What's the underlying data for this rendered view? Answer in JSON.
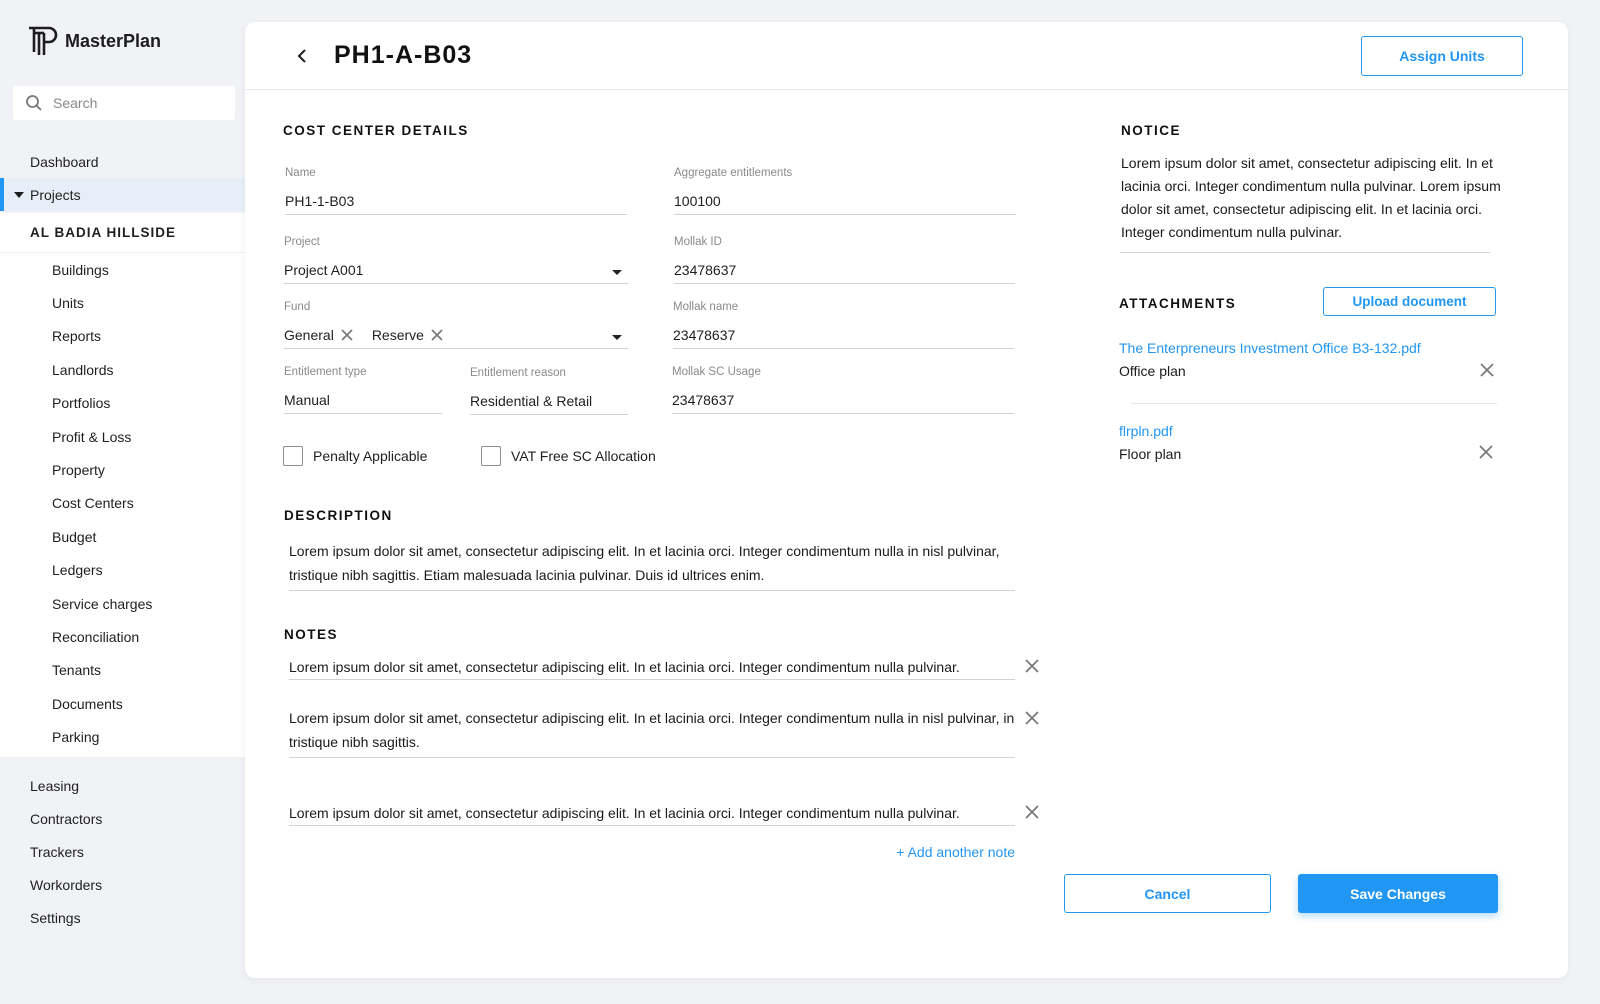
{
  "app": {
    "name": "MasterPlan"
  },
  "search": {
    "placeholder": "Search"
  },
  "nav": {
    "top": [
      "Dashboard",
      "Projects"
    ],
    "sub_heading": "AL BADIA HILLSIDE",
    "sub_items": [
      "Buildings",
      "Units",
      "Reports",
      "Landlords",
      "Portfolios",
      "Profit & Loss",
      "Property",
      "Cost Centers",
      "Budget",
      "Ledgers",
      "Service charges",
      "Reconciliation",
      "Tenants",
      "Documents",
      "Parking"
    ],
    "bottom": [
      "Leasing",
      "Contractors",
      "Trackers",
      "Workorders",
      "Settings"
    ]
  },
  "header": {
    "title": "PH1-A-B03",
    "assign_units": "Assign Units"
  },
  "cost_center": {
    "section_title": "COST CENTER DETAILS",
    "name": {
      "label": "Name",
      "value": "PH1-1-B03"
    },
    "aggregate": {
      "label": "Aggregate entitlements",
      "value": "100100"
    },
    "project": {
      "label": "Project",
      "value": "Project A001"
    },
    "mollak_id": {
      "label": "Mollak ID",
      "value": "23478637"
    },
    "fund": {
      "label": "Fund",
      "chips": [
        "General",
        "Reserve"
      ]
    },
    "mollak_name": {
      "label": "Mollak name",
      "value": "23478637"
    },
    "entitlement_type": {
      "label": "Entitlement type",
      "value": "Manual"
    },
    "entitlement_reason": {
      "label": "Entitlement reason",
      "value": "Residential & Retail"
    },
    "mollak_sc_usage": {
      "label": "Mollak SC Usage",
      "value": "23478637"
    },
    "penalty": "Penalty Applicable",
    "vat_free": "VAT Free SC Allocation"
  },
  "description": {
    "title": "DESCRIPTION",
    "text": "Lorem ipsum dolor sit amet, consectetur adipiscing elit. In et lacinia orci. Integer condimentum nulla in nisl pulvinar, tristique nibh sagittis. Etiam malesuada lacinia pulvinar. Duis id ultrices enim."
  },
  "notes": {
    "title": "NOTES",
    "items": [
      "Lorem ipsum dolor sit amet, consectetur adipiscing elit. In et lacinia orci. Integer condimentum nulla pulvinar.",
      "Lorem ipsum dolor sit amet, consectetur adipiscing elit. In et lacinia orci. Integer condimentum nulla in nisl pulvinar, in tristique nibh sagittis.",
      "Lorem ipsum dolor sit amet, consectetur adipiscing elit. In et lacinia orci. Integer condimentum nulla pulvinar."
    ],
    "add_label": "+ Add another note"
  },
  "notice": {
    "title": "NOTICE",
    "text": "Lorem ipsum dolor sit amet, consectetur adipiscing elit. In et lacinia orci. Integer condimentum nulla pulvinar. Lorem ipsum dolor sit amet, consectetur adipiscing elit. In et lacinia orci. Integer condimentum nulla pulvinar."
  },
  "attachments": {
    "title": "ATTACHMENTS",
    "upload_label": "Upload document",
    "items": [
      {
        "file": "The Enterpreneurs Investment Office  B3-132.pdf",
        "desc": "Office plan"
      },
      {
        "file": "flrpln.pdf",
        "desc": "Floor plan"
      }
    ]
  },
  "actions": {
    "cancel": "Cancel",
    "save": "Save Changes"
  },
  "colors": {
    "accent": "#2196f3",
    "background": "#f0f2f5",
    "active_nav_bg": "#e6eef7"
  }
}
